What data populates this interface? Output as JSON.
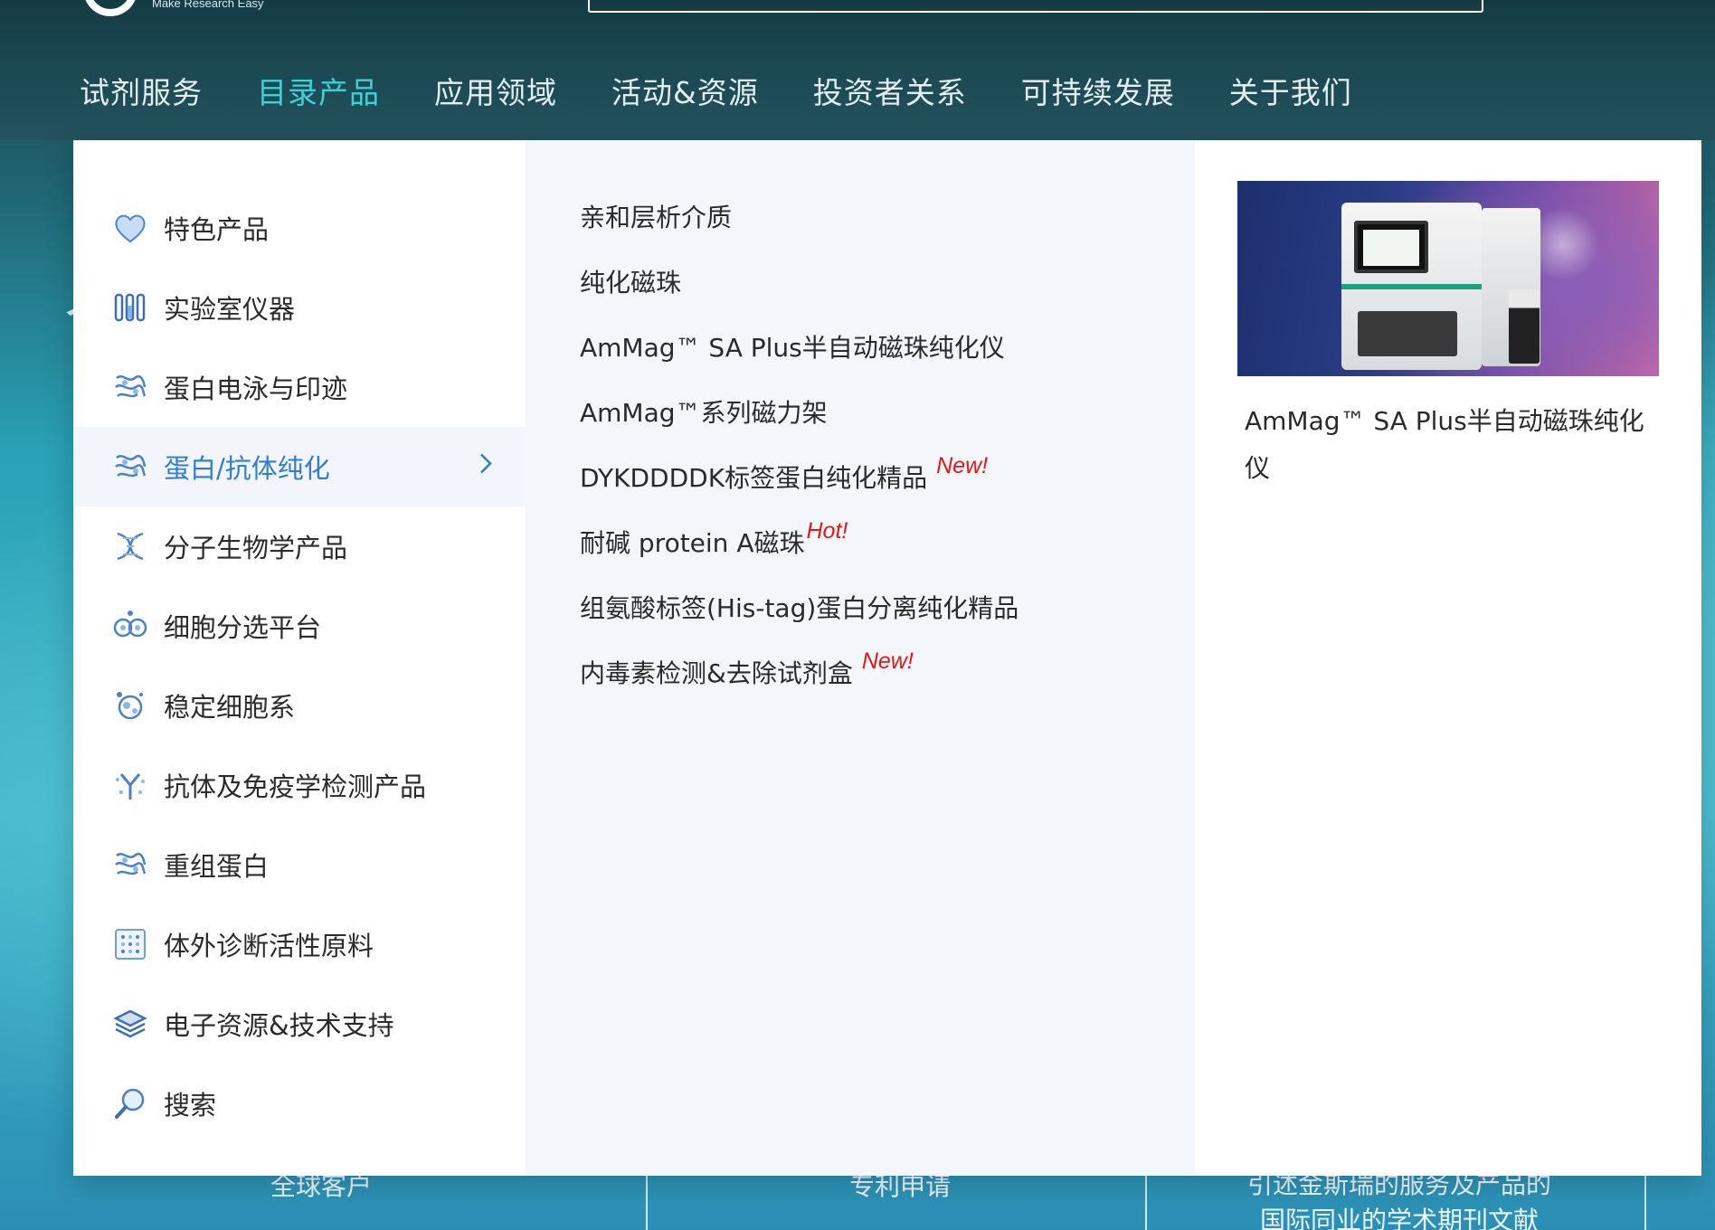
{
  "header": {
    "tagline": "Make Research Easy",
    "nav": [
      {
        "label": "试剂服务",
        "active": false
      },
      {
        "label": "目录产品",
        "active": true
      },
      {
        "label": "应用领域",
        "active": false
      },
      {
        "label": "活动&资源",
        "active": false
      },
      {
        "label": "投资者关系",
        "active": false
      },
      {
        "label": "可持续发展",
        "active": false
      },
      {
        "label": "关于我们",
        "active": false
      }
    ]
  },
  "menu": {
    "categories": [
      {
        "label": "特色产品",
        "icon": "heart-icon"
      },
      {
        "label": "实验室仪器",
        "icon": "test-tubes-icon"
      },
      {
        "label": "蛋白电泳与印迹",
        "icon": "protein-icon"
      },
      {
        "label": "蛋白/抗体纯化",
        "icon": "protein-icon",
        "active": true
      },
      {
        "label": "分子生物学产品",
        "icon": "dna-icon"
      },
      {
        "label": "细胞分选平台",
        "icon": "cells-icon"
      },
      {
        "label": "稳定细胞系",
        "icon": "cell-line-icon"
      },
      {
        "label": "抗体及免疫学检测产品",
        "icon": "antibody-icon"
      },
      {
        "label": "重组蛋白",
        "icon": "protein-icon"
      },
      {
        "label": "体外诊断活性原料",
        "icon": "grid-icon"
      },
      {
        "label": "电子资源&技术支持",
        "icon": "layers-icon"
      },
      {
        "label": "搜索",
        "icon": "search-icon"
      }
    ],
    "chevron": "chevron-right-icon",
    "subitems": [
      {
        "label": "亲和层析介质",
        "badge": ""
      },
      {
        "label": "纯化磁珠",
        "badge": ""
      },
      {
        "label": "AmMag™ SA Plus半自动磁珠纯化仪",
        "badge": ""
      },
      {
        "label": "AmMag™系列磁力架",
        "badge": ""
      },
      {
        "label": "DYKDDDDK标签蛋白纯化精品",
        "badge": "New!"
      },
      {
        "label": "耐碱 protein A磁珠",
        "badge": "Hot!"
      },
      {
        "label": "组氨酸标签(His-tag)蛋白分离纯化精品",
        "badge": ""
      },
      {
        "label": "内毒素检测&去除试剂盒",
        "badge": "New!"
      }
    ],
    "feature": {
      "caption": "AmMag™ SA Plus半自动磁珠纯化仪"
    }
  },
  "background": {
    "stats": [
      "全球客户",
      "专利申请",
      "引述金斯瑞的服务及产品的",
      "国际同业的学术期刊文献"
    ]
  },
  "colors": {
    "nav_active": "#3fd0d8",
    "menu_active": "#2f7cd6",
    "badge": "#e61717"
  }
}
